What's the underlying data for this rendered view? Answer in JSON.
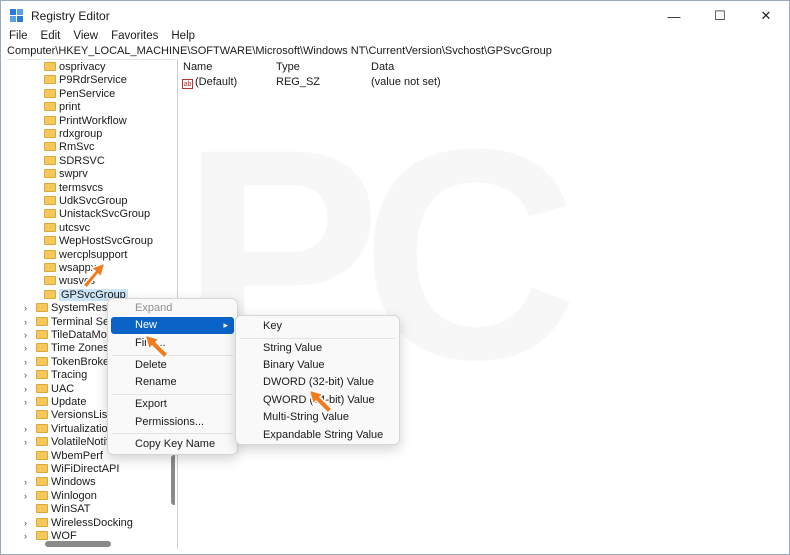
{
  "window": {
    "title": "Registry Editor",
    "controls": {
      "minimize": "—",
      "maximize": "☐",
      "close": "✕"
    }
  },
  "menu": [
    "File",
    "Edit",
    "View",
    "Favorites",
    "Help"
  ],
  "address": "Computer\\HKEY_LOCAL_MACHINE\\SOFTWARE\\Microsoft\\Windows NT\\CurrentVersion\\Svchost\\GPSvcGroup",
  "tree": {
    "children": [
      "osprivacy",
      "P9RdrService",
      "PenService",
      "print",
      "PrintWorkflow",
      "rdxgroup",
      "RmSvc",
      "SDRSVC",
      "swprv",
      "termsvcs",
      "UdkSvcGroup",
      "UnistackSvcGroup",
      "utcsvc",
      "WepHostSvcGroup",
      "wercplsupport",
      "wsappx",
      "wusvcs",
      "GPSvcGroup"
    ],
    "siblings": [
      "SystemRestore",
      "Terminal Server",
      "TileDataModel",
      "Time Zones",
      "TokenBroker",
      "Tracing",
      "UAC",
      "Update",
      "VersionsList",
      "Virtualization",
      "VolatileNotifications",
      "WbemPerf",
      "WiFiDirectAPI",
      "Windows",
      "Winlogon",
      "WinSAT",
      "WirelessDocking",
      "WOF"
    ],
    "expandable": [
      true,
      true,
      true,
      true,
      true,
      true,
      true,
      true,
      false,
      true,
      true,
      false,
      false,
      true,
      true,
      false,
      true,
      true
    ],
    "selected": "GPSvcGroup"
  },
  "list": {
    "headers": {
      "name": "Name",
      "type": "Type",
      "data": "Data"
    },
    "rows": [
      {
        "icon": "ab",
        "name": "(Default)",
        "type": "REG_SZ",
        "data": "(value not set)"
      }
    ]
  },
  "context_menu": {
    "items": [
      {
        "label": "Expand",
        "disabled": true
      },
      {
        "label": "New",
        "highlight": true,
        "submenu": true
      },
      {
        "label": "Find..."
      },
      {
        "label": "Delete"
      },
      {
        "label": "Rename"
      },
      {
        "label": "Export"
      },
      {
        "label": "Permissions..."
      },
      {
        "label": "Copy Key Name"
      }
    ]
  },
  "submenu": {
    "items": [
      "Key",
      "String Value",
      "Binary Value",
      "DWORD (32-bit) Value",
      "QWORD (64-bit) Value",
      "Multi-String Value",
      "Expandable String Value"
    ]
  },
  "watermark": "PC",
  "colors": {
    "highlight": "#0a64c8",
    "selection": "#cce4f7",
    "folder": "#f4c85a",
    "pointer": "#f07c1e"
  }
}
